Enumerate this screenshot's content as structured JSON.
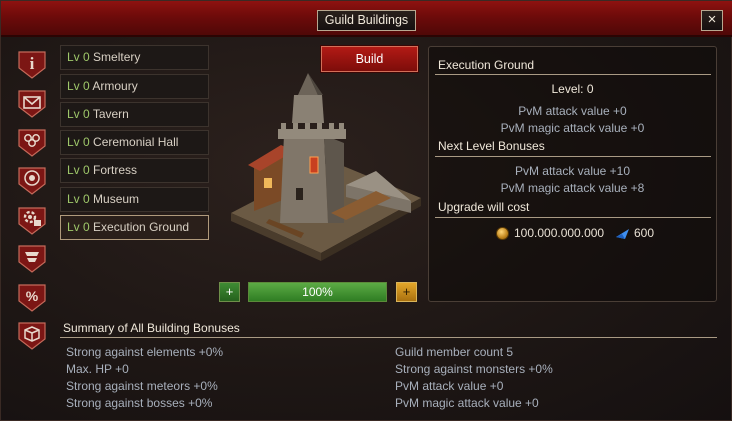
{
  "window": {
    "title": "Guild Buildings",
    "close_label": "×"
  },
  "side_icons": [
    "info-icon",
    "mail-icon",
    "members-icon",
    "emblem-icon",
    "settings-icon",
    "ranking-icon",
    "percent-icon",
    "box-icon"
  ],
  "side_icon_text": {
    "info": "i",
    "percent": "%"
  },
  "buildings": [
    {
      "level": "Lv 0",
      "name": "Smeltery"
    },
    {
      "level": "Lv 0",
      "name": "Armoury"
    },
    {
      "level": "Lv 0",
      "name": "Tavern"
    },
    {
      "level": "Lv 0",
      "name": "Ceremonial Hall"
    },
    {
      "level": "Lv 0",
      "name": "Fortress"
    },
    {
      "level": "Lv 0",
      "name": "Museum"
    },
    {
      "level": "Lv 0",
      "name": "Execution Ground"
    }
  ],
  "build_button": "Build",
  "progress": {
    "text": "100%",
    "value": 1.0
  },
  "plus_label": "+",
  "info": {
    "title": "Execution Ground",
    "level": "Level: 0",
    "current": [
      "PvM attack value +0",
      "PvM magic attack value +0"
    ],
    "next_header": "Next Level Bonuses",
    "next": [
      "PvM attack value +10",
      "PvM magic attack value +8"
    ],
    "cost_header": "Upgrade will cost",
    "cost_gold": "100.000.000.000",
    "cost_gems": "600"
  },
  "summary": {
    "title": "Summary of All Building Bonuses",
    "left": [
      "Strong against elements +0%",
      "Max. HP +0",
      "Strong against meteors +0%",
      "Strong against bosses +0%"
    ],
    "right": [
      "Guild member count 5",
      "Strong against monsters +0%",
      "PvM attack value +0",
      "PvM magic attack value +0"
    ]
  },
  "colors": {
    "title_red": "#8e1210",
    "level_green": "#9fc86a",
    "progress_green": "#5cab45",
    "stat_text": "#a8b0bc"
  }
}
